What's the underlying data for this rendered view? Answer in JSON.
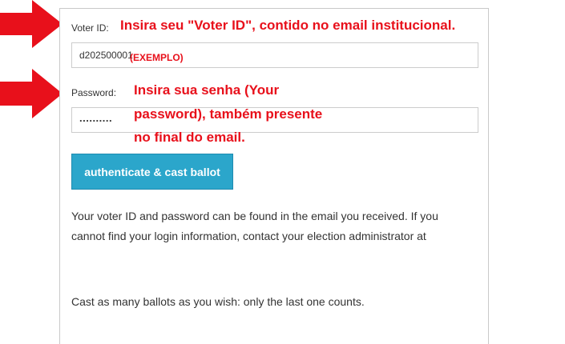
{
  "form": {
    "voter_id_label": "Voter ID:",
    "voter_id_value": "d202500001",
    "password_label": "Password:",
    "password_value": "..........",
    "submit_label": "authenticate & cast ballot",
    "help_text": "Your voter ID and password can be found in the email you received. If you cannot find your login information, contact your election administrator at",
    "tip_text": "Cast as many ballots as you wish: only the last one counts."
  },
  "annotations": {
    "voter_id_hint": "Insira seu \"Voter ID\", contido no email institucional.",
    "example_tag": "(EXEMPLO)",
    "password_hint_line1": "Insira sua senha (Your",
    "password_hint_line2": "password), também presente",
    "password_hint_line3": "no final do email.",
    "color": "#e8101b",
    "arrow_icon": "red-right-arrow"
  },
  "colors": {
    "button_bg": "#2ba6cb",
    "button_text": "#ffffff"
  }
}
